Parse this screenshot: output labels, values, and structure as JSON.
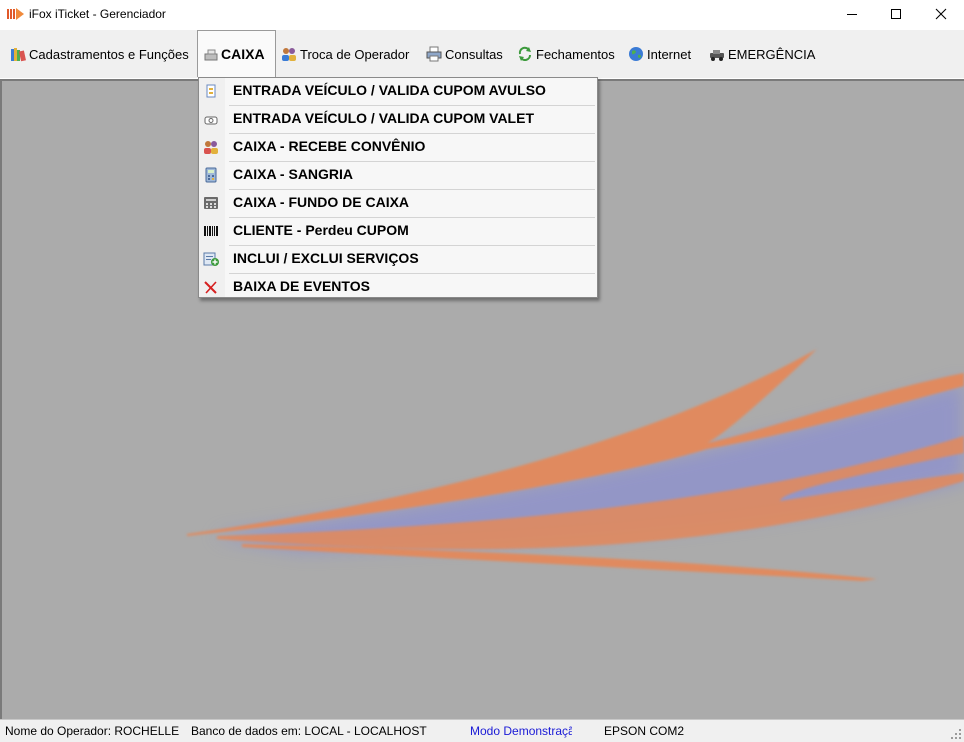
{
  "window": {
    "title": "iFox iTicket - Gerenciador",
    "app_icon": "ifox-logo-icon",
    "controls": [
      "minimize-icon",
      "maximize-icon",
      "close-icon"
    ]
  },
  "menubar": {
    "items": [
      {
        "label": "Cadastramentos e Funções",
        "icon": "books-icon"
      },
      {
        "label": "CAIXA",
        "icon": "cash-register-icon",
        "active": true
      },
      {
        "label": "Troca de Operador",
        "icon": "users-icon"
      },
      {
        "label": "Consultas",
        "icon": "printer-icon"
      },
      {
        "label": "Fechamentos",
        "icon": "refresh-icon"
      },
      {
        "label": "Internet",
        "icon": "globe-icon"
      },
      {
        "label": "EMERGÊNCIA",
        "icon": "car-crash-icon"
      }
    ]
  },
  "caixa_menu": {
    "items": [
      {
        "label": "ENTRADA VEÍCULO / VALIDA CUPOM AVULSO",
        "icon": "ticket-icon"
      },
      {
        "label": "ENTRADA VEÍCULO / VALIDA CUPOM VALET",
        "icon": "valet-icon"
      },
      {
        "label": "CAIXA - RECEBE CONVÊNIO",
        "icon": "agreement-icon"
      },
      {
        "label": "CAIXA - SANGRIA",
        "icon": "calculator-icon"
      },
      {
        "label": "CAIXA - FUNDO DE CAIXA",
        "icon": "keypad-icon"
      },
      {
        "label": "CLIENTE - Perdeu CUPOM",
        "icon": "barcode-icon"
      },
      {
        "label": "INCLUI / EXCLUI SERVIÇOS",
        "icon": "add-service-icon"
      },
      {
        "label": "BAIXA DE EVENTOS",
        "icon": "red-x-icon"
      }
    ]
  },
  "statusbar": {
    "operator": "Nome do Operador: ROCHELLE",
    "database": "Banco de dados em: LOCAL - LOCALHOST",
    "mode": "Modo Demonstração",
    "printer": "EPSON COM2"
  },
  "colors": {
    "mdi_background": "#ababab",
    "swoosh_orange": "#e08a5e",
    "swoosh_blue": "#7a7fd0",
    "mode_text": "#1a1ad6"
  }
}
